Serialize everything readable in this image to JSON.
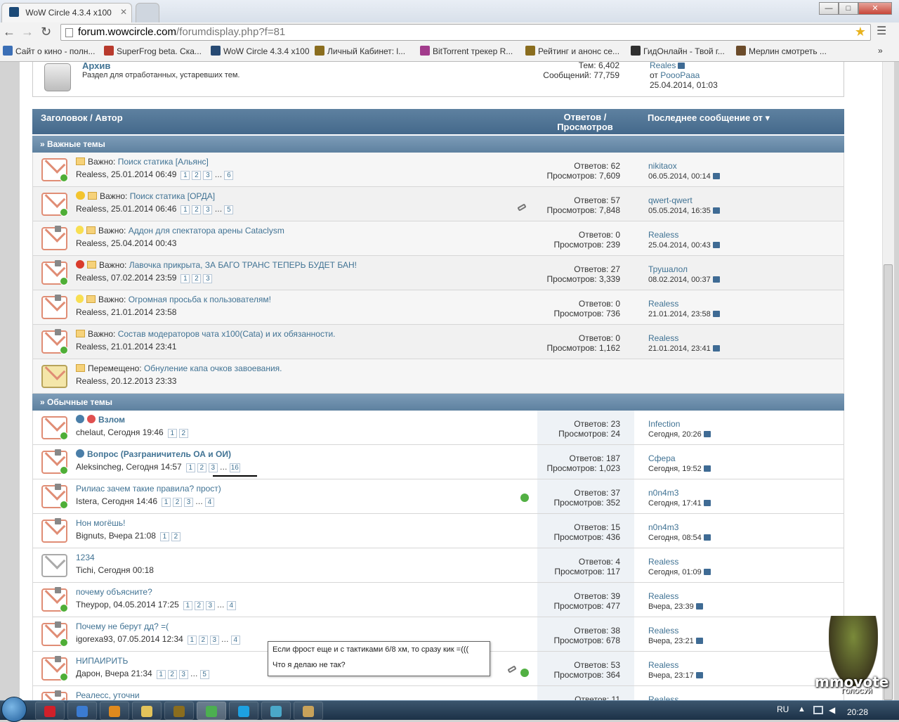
{
  "browser": {
    "tab_title": "WoW Circle 4.3.4 x100",
    "url_domain": "forum.wowcircle.com",
    "url_path": "/forumdisplay.php?f=81",
    "window_buttons": [
      "—",
      "□",
      "✕"
    ]
  },
  "bookmarks": [
    {
      "label": "Сайт о кино - полн...",
      "color": "#3b6fb6"
    },
    {
      "label": "SuperFrog beta. Ска...",
      "color": "#b83a2d"
    },
    {
      "label": "WoW Circle 4.3.4 x100",
      "color": "#274a73"
    },
    {
      "label": "Личный Кабинет: l...",
      "color": "#8a6d1e"
    },
    {
      "label": "BitTorrent трекер R...",
      "color": "#a23b8c"
    },
    {
      "label": "Рейтинг и анонс се...",
      "color": "#8a6d1e"
    },
    {
      "label": "ГидОнлайн - Твой г...",
      "color": "#2f2f2f"
    },
    {
      "label": "Мерлин смотреть ...",
      "color": "#6b4b2a"
    }
  ],
  "bookmarks_more": "»",
  "forum": {
    "title": "Архив",
    "desc": "Раздел для отработанных, устаревших тем.",
    "threads": "Тем: 6,402",
    "posts": "Сообщений: 77,759",
    "last_author": "Reales",
    "last_from_prefix": "от",
    "last_from": "PoooPaaa",
    "last_date": "25.04.2014, 01:03"
  },
  "header": {
    "col_title": "Заголовок / Автор",
    "col_stats_1": "Ответов /",
    "col_stats_2": "Просмотров",
    "col_last": "Последнее сообщение от"
  },
  "sections": {
    "sticky": "» Важные темы",
    "normal": "» Обычные темы"
  },
  "sticky": [
    {
      "prefix": "Важно:",
      "title": "Поиск статика [Альянс]",
      "author": "Realess, 25.01.2014 06:49",
      "pages": [
        "1",
        "2",
        "3",
        "…",
        "6"
      ],
      "replies": "Ответов: 62",
      "views": "Просмотров: 7,609",
      "last_user": "nikitaox",
      "last_date": "06.05.2014, 00:14"
    },
    {
      "prefix": "Важно:",
      "title": "Поиск статика [ОРДА]",
      "author": "Realess, 25.01.2014 06:46",
      "pages": [
        "1",
        "2",
        "3",
        "…",
        "5"
      ],
      "replies": "Ответов: 57",
      "views": "Просмотров: 7,848",
      "last_user": "qwert-qwert",
      "last_date": "05.05.2014, 16:35"
    },
    {
      "prefix": "Важно:",
      "title": "Аддон для спектатора арены Cataclysm",
      "author": "Realess, 25.04.2014 00:43",
      "pages": [],
      "replies": "Ответов: 0",
      "views": "Просмотров: 239",
      "last_user": "Realess",
      "last_date": "25.04.2014, 00:43"
    },
    {
      "prefix": "Важно:",
      "title": "Лавочка прикрыта, ЗА БАГО ТРАНС ТЕПЕРЬ БУДЕТ БАН!",
      "author": "Realess, 07.02.2014 23:59",
      "pages": [
        "1",
        "2",
        "3"
      ],
      "replies": "Ответов: 27",
      "views": "Просмотров: 3,339",
      "last_user": "Трушалол",
      "last_date": "08.02.2014, 00:37"
    },
    {
      "prefix": "Важно:",
      "title": "Огромная просьба к пользователям!",
      "author": "Realess, 21.01.2014 23:58",
      "pages": [],
      "replies": "Ответов: 0",
      "views": "Просмотров: 736",
      "last_user": "Realess",
      "last_date": "21.01.2014, 23:58"
    },
    {
      "prefix": "Важно:",
      "title": "Состав модераторов чата x100(Cata) и их обязанности.",
      "author": "Realess, 21.01.2014 23:41",
      "pages": [],
      "replies": "Ответов: 0",
      "views": "Просмотров: 1,162",
      "last_user": "Realess",
      "last_date": "21.01.2014, 23:41"
    },
    {
      "prefix": "Перемещено:",
      "title": "Обнуление капа очков завоевания.",
      "author": "Realess, 20.12.2013 23:33",
      "pages": [],
      "replies": "",
      "views": "",
      "last_user": "",
      "last_date": ""
    }
  ],
  "normal": [
    {
      "title": "Взлом",
      "author": "chelaut, Сегодня 19:46",
      "pages": [
        "1",
        "2"
      ],
      "replies": "Ответов: 23",
      "views": "Просмотров: 24",
      "last_user": "Infection",
      "last_date": "Сегодня, 20:26"
    },
    {
      "title": "Вопрос (Разграничитель ОА и ОИ)",
      "author": "Aleksincheg, Сегодня 14:57",
      "pages": [
        "1",
        "2",
        "3",
        "…",
        "16"
      ],
      "replies": "Ответов: 187",
      "views": "Просмотров: 1,023",
      "last_user": "Сфера",
      "last_date": "Сегодня, 19:52"
    },
    {
      "title": "Рилиас зачем такие правила? прост)",
      "author": "Istera, Сегодня 14:46",
      "pages": [
        "1",
        "2",
        "3",
        "…",
        "4"
      ],
      "replies": "Ответов: 37",
      "views": "Просмотров: 352",
      "last_user": "n0n4m3",
      "last_date": "Сегодня, 17:41"
    },
    {
      "title": "Нон могёшь!",
      "author": "Bignuts, Вчера 21:08",
      "pages": [
        "1",
        "2"
      ],
      "replies": "Ответов: 15",
      "views": "Просмотров: 436",
      "last_user": "n0n4m3",
      "last_date": "Сегодня, 08:54"
    },
    {
      "title": "1234",
      "author": "Tichi, Сегодня 00:18",
      "pages": [],
      "replies": "Ответов: 4",
      "views": "Просмотров: 117",
      "last_user": "Realess",
      "last_date": "Сегодня, 01:09"
    },
    {
      "title": "почему объясните?",
      "author": "Theypop, 04.05.2014 17:25",
      "pages": [
        "1",
        "2",
        "3",
        "…",
        "4"
      ],
      "replies": "Ответов: 39",
      "views": "Просмотров: 477",
      "last_user": "Realess",
      "last_date": "Вчера, 23:39"
    },
    {
      "title": "Почему не берут дд? =(",
      "author": "igorexa93, 07.05.2014 12:34",
      "pages": [
        "1",
        "2",
        "3",
        "…",
        "4"
      ],
      "replies": "Ответов: 38",
      "views": "Просмотров: 678",
      "last_user": "Realess",
      "last_date": "Вчера, 23:21"
    },
    {
      "title": "НИПАИРИТЬ",
      "author": "Дарон, Вчера 21:34",
      "pages": [
        "1",
        "2",
        "3",
        "…",
        "5"
      ],
      "replies": "Ответов: 53",
      "views": "Просмотров: 364",
      "last_user": "Realess",
      "last_date": "Вчера, 23:17"
    },
    {
      "title": "Реалесс, уточни",
      "author": "",
      "pages": [],
      "replies": "Ответов: 11",
      "views": "",
      "last_user": "Realess",
      "last_date": ""
    }
  ],
  "tooltip": {
    "line1": "Если фрост еще и с тактиками 6/8 хм, то сразу кик =(((",
    "line2": "Что я делаю не так?"
  },
  "widget": {
    "brand": "mmovote",
    "sub": "ГОЛОСУЙ"
  },
  "taskbar": {
    "lang": "RU",
    "clock": "20:28",
    "apps": [
      {
        "name": "opera-icon",
        "color": "#d0202a"
      },
      {
        "name": "internet-explorer-icon",
        "color": "#3b7bd1"
      },
      {
        "name": "media-player-icon",
        "color": "#e08a1e"
      },
      {
        "name": "file-explorer-icon",
        "color": "#e3c35a"
      },
      {
        "name": "wow-icon",
        "color": "#8a6d1e"
      },
      {
        "name": "chrome-icon",
        "color": "#4caf50"
      },
      {
        "name": "skype-icon",
        "color": "#1da1e2"
      },
      {
        "name": "star-app-icon",
        "color": "#4aa8c9"
      },
      {
        "name": "paint-icon",
        "color": "#c8a25a"
      }
    ]
  }
}
